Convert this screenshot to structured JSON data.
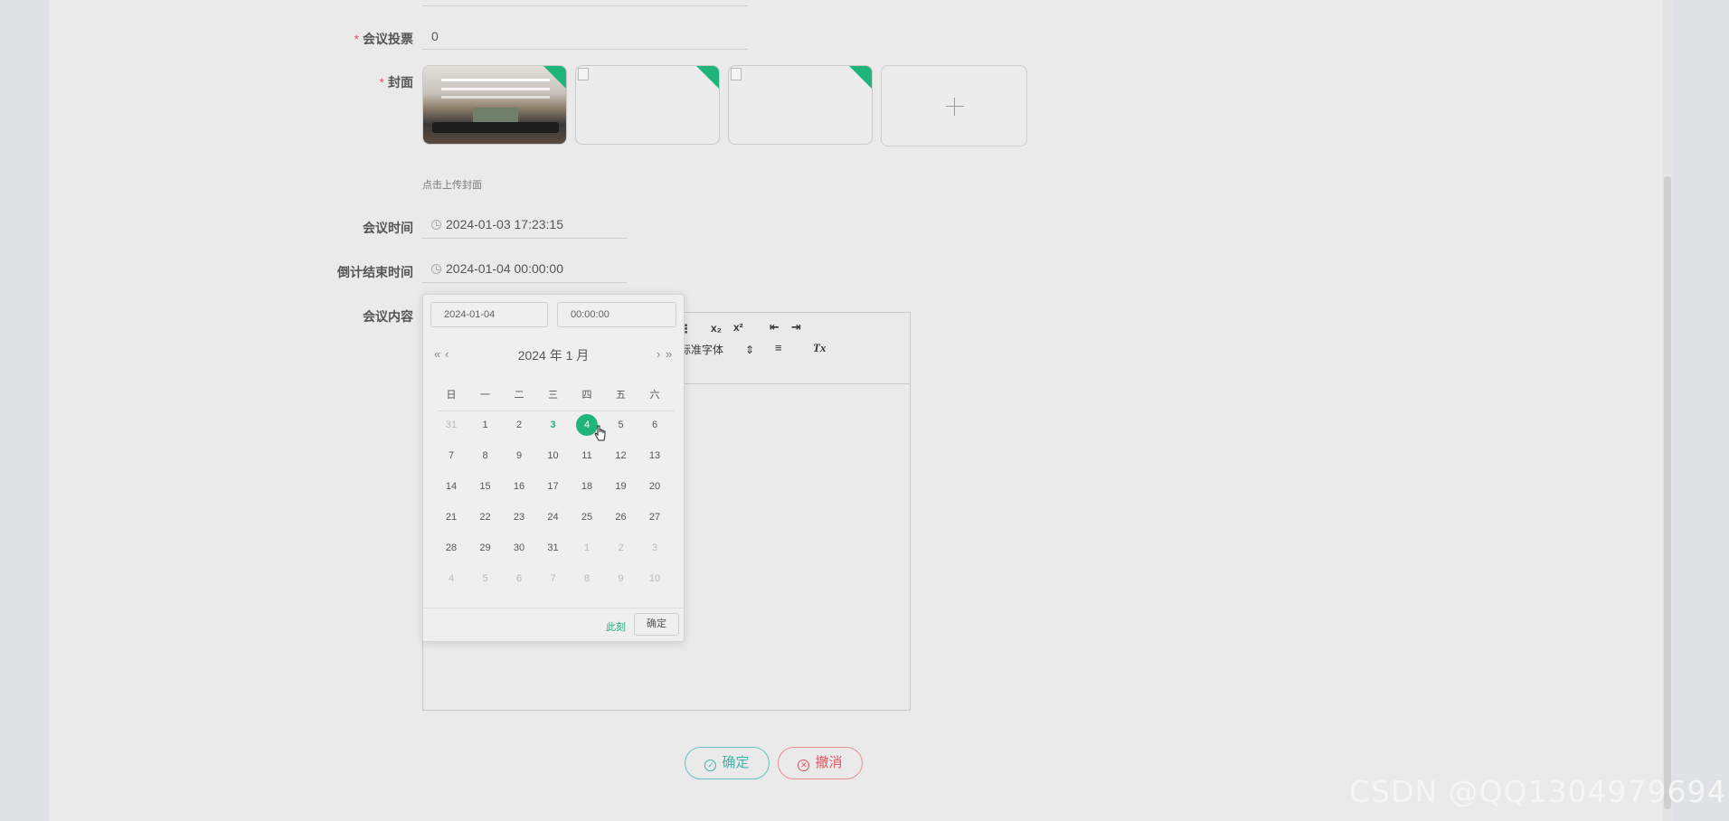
{
  "form": {
    "votes_label": "会议投票",
    "votes_value": "0",
    "cover_label": "封面",
    "cover_hint": "点击上传封面",
    "meeting_time_label": "会议时间",
    "meeting_time_value": "2024-01-03 17:23:15",
    "countdown_label": "倒计结束时间",
    "countdown_value": "2024-01-04 00:00:00",
    "content_label": "会议内容",
    "required_mark": "*"
  },
  "editor_toolbar": {
    "font_select": "标准字体",
    "subscript": "x₂",
    "superscript": "x²",
    "clean_format": "Tx"
  },
  "date_picker": {
    "date_input": "2024-01-04",
    "time_input": "00:00:00",
    "header": "2024 年  1 月",
    "prev_year": "«",
    "prev_month": "‹",
    "next_month": "›",
    "next_year": "»",
    "weekdays": [
      "日",
      "一",
      "二",
      "三",
      "四",
      "五",
      "六"
    ],
    "weeks": [
      [
        "31",
        "1",
        "2",
        "3",
        "4",
        "5",
        "6"
      ],
      [
        "7",
        "8",
        "9",
        "10",
        "11",
        "12",
        "13"
      ],
      [
        "14",
        "15",
        "16",
        "17",
        "18",
        "19",
        "20"
      ],
      [
        "21",
        "22",
        "23",
        "24",
        "25",
        "26",
        "27"
      ],
      [
        "28",
        "29",
        "30",
        "31",
        "1",
        "2",
        "3"
      ],
      [
        "4",
        "5",
        "6",
        "7",
        "8",
        "9",
        "10"
      ]
    ],
    "today": "3",
    "selected": "4",
    "now_label": "此刻",
    "confirm_label": "确定"
  },
  "actions": {
    "confirm_label": "确定",
    "cancel_label": "撤消"
  },
  "watermark": "CSDN @QQ1304979694",
  "colors": {
    "accent": "#1fb479",
    "confirm": "#42b3a9",
    "cancel": "#e2565f",
    "required": "#e0546a"
  }
}
